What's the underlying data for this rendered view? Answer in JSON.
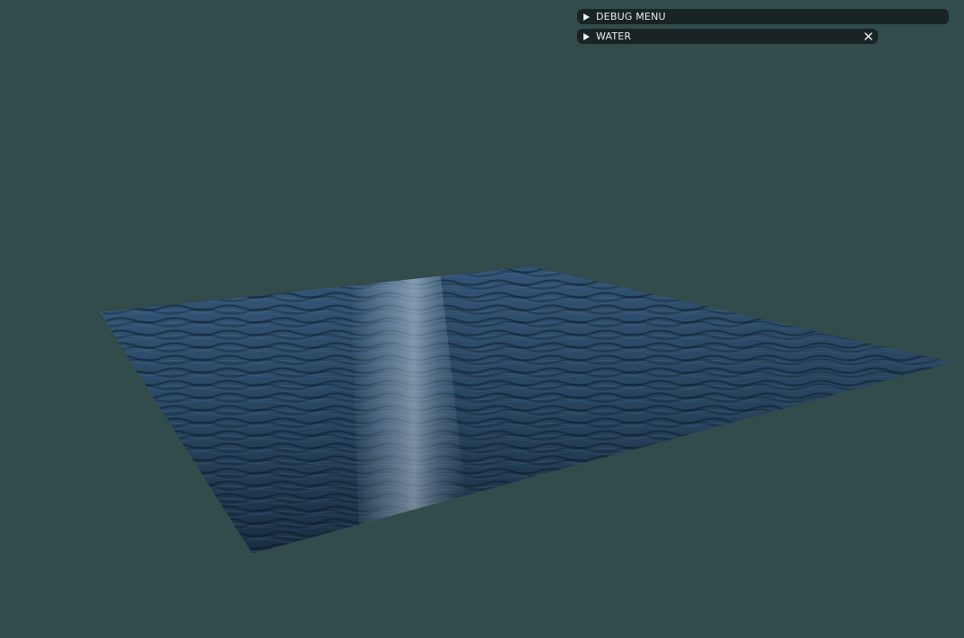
{
  "colors": {
    "background": "#324b4b",
    "panel": "#192424",
    "panel_text": "#e9eeee",
    "water_dark": "#16283a",
    "water_mid": "#2c4e6c",
    "water_light": "#6f8ba3"
  },
  "ui": {
    "debug_menu": {
      "label": "DEBUG MENU",
      "icon": "collapse-arrow-icon"
    },
    "water_window": {
      "label": "WATER",
      "icon": "collapse-arrow-icon",
      "close_icon": "close-icon"
    }
  },
  "scene": {
    "object": "water-plane"
  }
}
